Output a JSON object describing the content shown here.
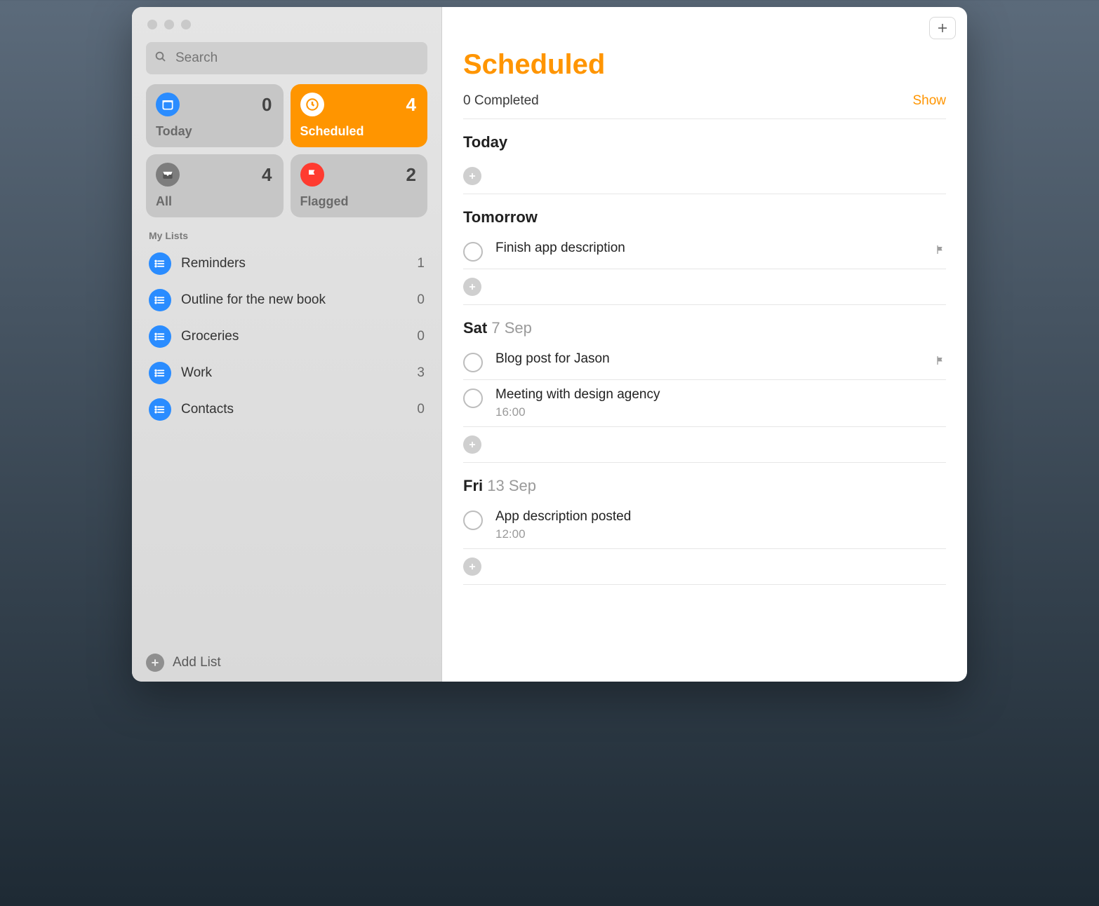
{
  "search": {
    "placeholder": "Search"
  },
  "tiles": {
    "today": {
      "label": "Today",
      "count": "0"
    },
    "scheduled": {
      "label": "Scheduled",
      "count": "4"
    },
    "all": {
      "label": "All",
      "count": "4"
    },
    "flagged": {
      "label": "Flagged",
      "count": "2"
    }
  },
  "listsHeader": "My Lists",
  "lists": [
    {
      "name": "Reminders",
      "count": "1"
    },
    {
      "name": "Outline for the new book",
      "count": "0"
    },
    {
      "name": "Groceries",
      "count": "0"
    },
    {
      "name": "Work",
      "count": "3"
    },
    {
      "name": "Contacts",
      "count": "0"
    }
  ],
  "addListLabel": "Add List",
  "page": {
    "title": "Scheduled",
    "completed": "0 Completed",
    "showLink": "Show"
  },
  "groups": [
    {
      "labelBold": "Today",
      "labelThin": "",
      "items": []
    },
    {
      "labelBold": "Tomorrow",
      "labelThin": "",
      "items": [
        {
          "title": "Finish app description",
          "time": "",
          "flagged": true
        }
      ]
    },
    {
      "labelBold": "Sat",
      "labelThin": "7 Sep",
      "items": [
        {
          "title": "Blog post for Jason",
          "time": "",
          "flagged": true
        },
        {
          "title": "Meeting with design agency",
          "time": "16:00",
          "flagged": false
        }
      ]
    },
    {
      "labelBold": "Fri",
      "labelThin": "13 Sep",
      "items": [
        {
          "title": "App description posted",
          "time": "12:00",
          "flagged": false
        }
      ]
    }
  ]
}
